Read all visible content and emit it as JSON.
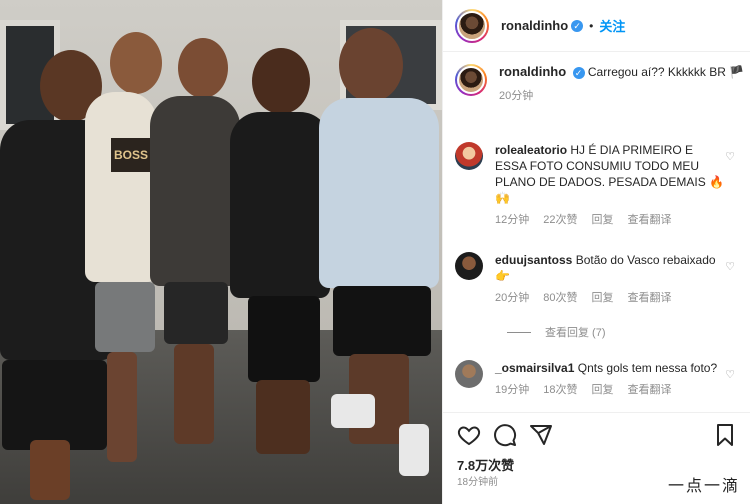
{
  "header": {
    "username": "ronaldinho",
    "follow_label": "关注",
    "dot": "•"
  },
  "caption": {
    "username": "ronaldinho",
    "text": "Carregou aí?? Kkkkkk BR",
    "flag_emoji": "🏴",
    "time": "20分钟"
  },
  "comments": [
    {
      "username": "rolealeatorio",
      "text": "HJ É DIA PRIMEIRO E ESSA FOTO CONSUMIU TODO MEU PLANO DE DADOS. PESADA DEMAIS 🔥🙌",
      "time": "12分钟",
      "likes": "22次赞",
      "reply": "回复",
      "translate": "查看翻译"
    },
    {
      "username": "eduujsantoss",
      "text": "Botão do Vasco rebaixado 👉",
      "time": "20分钟",
      "likes": "80次赞",
      "reply": "回复",
      "translate": "查看翻译"
    },
    {
      "username": "_osmairsilva1",
      "text": "Qnts gols tem nessa foto?",
      "time": "19分钟",
      "likes": "18次赞",
      "reply": "回复",
      "translate": "查看翻译"
    }
  ],
  "view_replies": "查看回复 (7)",
  "actions": {
    "likes_count": "7.8万次赞",
    "posted_ago": "18分钟前"
  },
  "watermark": "一点一滴",
  "icons": {
    "verified": "verified-badge-icon",
    "heart": "heart-icon",
    "comment": "comment-icon",
    "share": "share-icon",
    "bookmark": "bookmark-icon"
  },
  "colors": {
    "accent": "#0095f6",
    "verified": "#3897f0",
    "muted": "#8e8e8e",
    "text": "#262626"
  }
}
